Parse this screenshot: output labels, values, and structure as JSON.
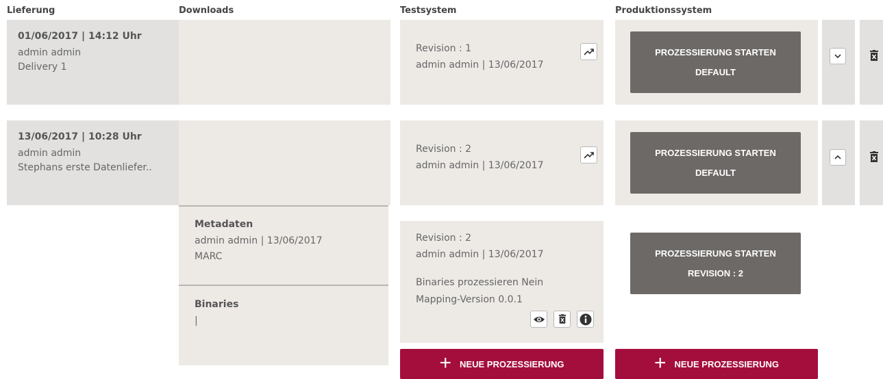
{
  "headers": {
    "delivery": "Lieferung",
    "downloads": "Downloads",
    "test": "Testsystem",
    "prod": "Produktionssystem"
  },
  "rows": [
    {
      "date": "01/06/2017 | 14:12 Uhr",
      "user": "admin admin",
      "name": "Delivery 1",
      "test_revision": "Revision : 1",
      "test_meta": "admin admin | 13/06/2017",
      "prod_line1": "PROZESSIERUNG STARTEN",
      "prod_line2": "DEFAULT",
      "toggle": "chevron-down"
    },
    {
      "date": "13/06/2017 | 10:28 Uhr",
      "user": "admin admin",
      "name": "Stephans erste Datenliefer..",
      "test_revision": "Revision : 2",
      "test_meta": "admin admin | 13/06/2017",
      "prod_line1": "PROZESSIERUNG STARTEN",
      "prod_line2": "DEFAULT",
      "toggle": "chevron-up"
    }
  ],
  "detail": {
    "metadata_title": "Metadaten",
    "metadata_meta": "admin admin | 13/06/2017",
    "metadata_format": "MARC",
    "binaries_title": "Binaries",
    "binaries_value": "|",
    "revision": "Revision : 2",
    "revision_meta": "admin admin | 13/06/2017",
    "binaries_process": "Binaries prozessieren Nein",
    "mapping_version": "Mapping-Version 0.0.1",
    "prod_line1": "PROZESSIERUNG STARTEN",
    "prod_line2": "REVISION : 2"
  },
  "actions": {
    "new_processing_test": "NEUE PROZESSIERUNG",
    "new_processing_prod": "NEUE PROZESSIERUNG"
  },
  "colors": {
    "accent": "#a40e3c",
    "button_dark": "#6d6966",
    "panel": "#edeae6"
  }
}
